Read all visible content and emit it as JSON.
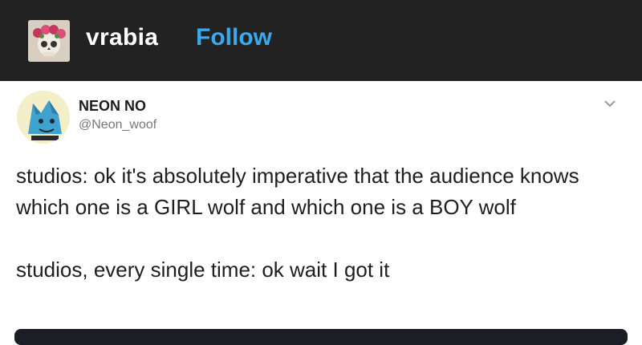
{
  "header": {
    "username": "vrabia",
    "follow_label": "Follow",
    "avatar_icon": "skull-flower-crown-icon"
  },
  "tweet": {
    "display_name": "NEON NO",
    "handle": "@Neon_woof",
    "avatar_icon": "blue-wolf-avatar-icon",
    "menu_icon": "chevron-down-icon",
    "text_line_1": "studios: ok it's absolutely imperative that the audience knows which one is a GIRL wolf and which one is a BOY wolf",
    "text_line_2": "studios, every single time: ok wait I got it"
  },
  "colors": {
    "header_bg": "#222222",
    "follow_blue": "#3aa9ee",
    "text": "#1e1e1e",
    "handle_grey": "#777777"
  }
}
